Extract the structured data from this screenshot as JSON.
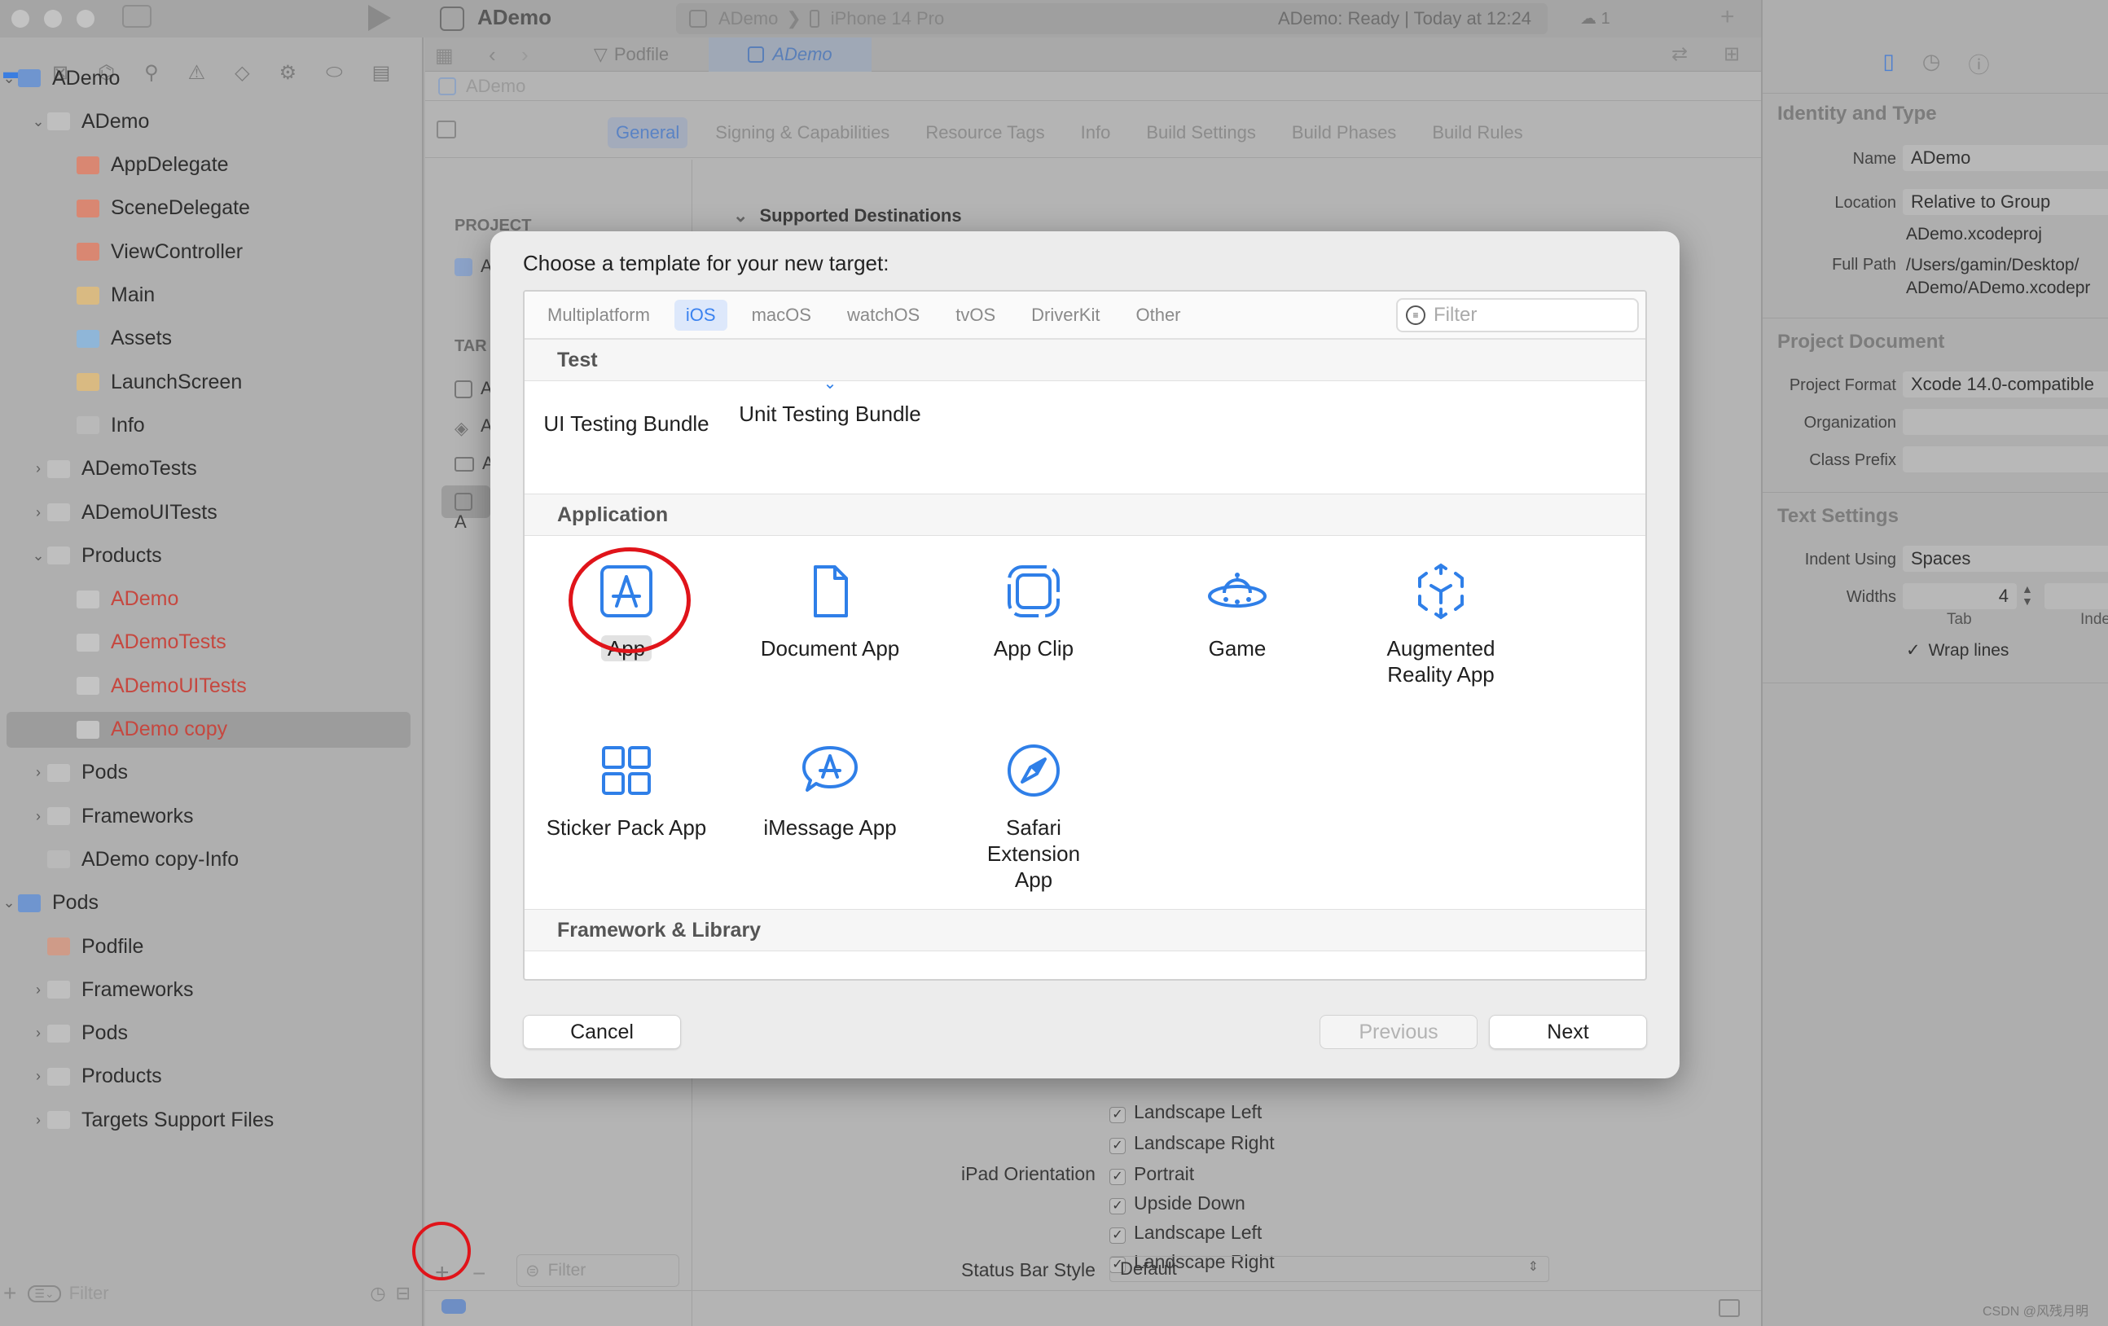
{
  "toolbar": {
    "project": "ADemo",
    "scheme": "ADemo",
    "device": "iPhone 14 Pro",
    "status": "ADemo: Ready | Today at 12:24",
    "warnings": "1"
  },
  "editor_tabs": [
    "Podfile",
    "ADemo"
  ],
  "breadcrumb": "ADemo",
  "settings_tabs": [
    "General",
    "Signing & Capabilities",
    "Resource Tags",
    "Info",
    "Build Settings",
    "Build Phases",
    "Build Rules"
  ],
  "targets_pane": {
    "project_header": "PROJECT",
    "targets_header": "TAR",
    "row_letter": "A",
    "filter_placeholder": "Filter"
  },
  "section_supported_destinations": "Supported Destinations",
  "orientation": {
    "iphone_rows": [
      "Landscape Left",
      "Landscape Right"
    ],
    "ipad_label": "iPad Orientation",
    "ipad_rows": [
      "Portrait",
      "Upside Down",
      "Landscape Left",
      "Landscape Right"
    ],
    "status_bar_label": "Status Bar Style",
    "status_bar_value": "Default"
  },
  "navigator": {
    "filter_placeholder": "Filter",
    "items": [
      {
        "label": "ADemo",
        "type": "project"
      },
      {
        "label": "ADemo",
        "type": "folder"
      },
      {
        "label": "AppDelegate",
        "type": "swift"
      },
      {
        "label": "SceneDelegate",
        "type": "swift"
      },
      {
        "label": "ViewController",
        "type": "swift"
      },
      {
        "label": "Main",
        "type": "xib"
      },
      {
        "label": "Assets",
        "type": "assets"
      },
      {
        "label": "LaunchScreen",
        "type": "xib"
      },
      {
        "label": "Info",
        "type": "plist"
      },
      {
        "label": "ADemoTests",
        "type": "folder"
      },
      {
        "label": "ADemoUITests",
        "type": "folder"
      },
      {
        "label": "Products",
        "type": "folder"
      },
      {
        "label": "ADemo",
        "type": "product"
      },
      {
        "label": "ADemoTests",
        "type": "product"
      },
      {
        "label": "ADemoUITests",
        "type": "product"
      },
      {
        "label": "ADemo copy",
        "type": "product"
      },
      {
        "label": "Pods",
        "type": "folder"
      },
      {
        "label": "Frameworks",
        "type": "folder"
      },
      {
        "label": "ADemo copy-Info",
        "type": "plist"
      },
      {
        "label": "Pods",
        "type": "project"
      },
      {
        "label": "Podfile",
        "type": "podfile"
      },
      {
        "label": "Frameworks",
        "type": "folder"
      },
      {
        "label": "Pods",
        "type": "folder"
      },
      {
        "label": "Products",
        "type": "folder"
      },
      {
        "label": "Targets Support Files",
        "type": "folder"
      }
    ]
  },
  "inspector": {
    "identity_title": "Identity and Type",
    "name_label": "Name",
    "name_value": "ADemo",
    "location_label": "Location",
    "location_value": "Relative to Group",
    "file_name": "ADemo.xcodeproj",
    "fullpath_label": "Full Path",
    "fullpath_line1": "/Users/gamin/Desktop/",
    "fullpath_line2": "ADemo/ADemo.xcodepr",
    "project_doc_title": "Project Document",
    "format_label": "Project Format",
    "format_value": "Xcode 14.0-compatible",
    "org_label": "Organization",
    "prefix_label": "Class Prefix",
    "text_settings_title": "Text Settings",
    "indent_label": "Indent Using",
    "indent_value": "Spaces",
    "widths_label": "Widths",
    "widths_value": "4",
    "tab_label": "Tab",
    "indent_col_label": "Inde",
    "wrap_label": "Wrap lines"
  },
  "modal": {
    "title": "Choose a template for your new target:",
    "platforms": [
      "Multiplatform",
      "iOS",
      "macOS",
      "watchOS",
      "tvOS",
      "DriverKit",
      "Other"
    ],
    "filter_placeholder": "Filter",
    "sections": {
      "test": "Test",
      "application": "Application",
      "framework": "Framework & Library"
    },
    "test_templates": [
      "UI Testing Bundle",
      "Unit Testing Bundle"
    ],
    "app_templates": [
      "App",
      "Document App",
      "App Clip",
      "Game",
      "Augmented Reality App",
      "Sticker Pack App",
      "iMessage App",
      "Safari Extension App"
    ],
    "cancel": "Cancel",
    "previous": "Previous",
    "next": "Next",
    "accent_color": "#2f7fe8"
  },
  "watermark": "CSDN @风残月明"
}
